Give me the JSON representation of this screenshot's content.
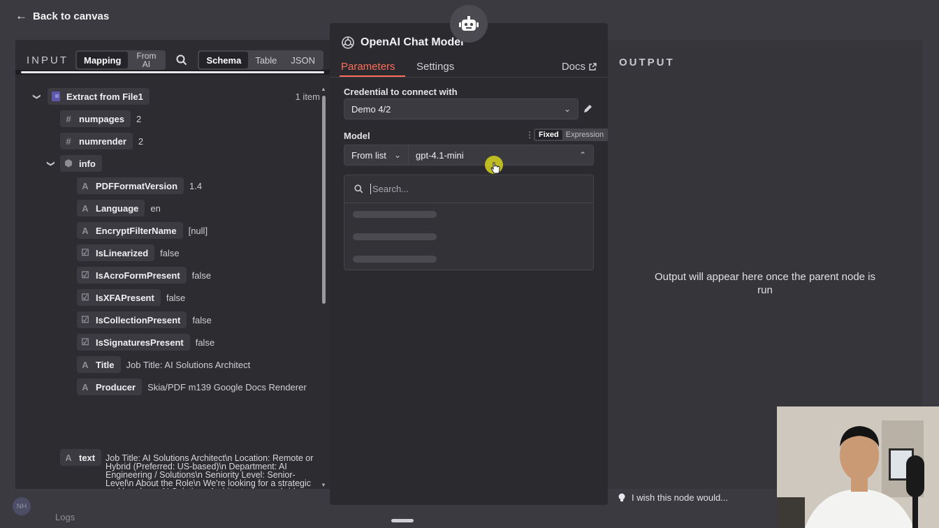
{
  "nav": {
    "back_label": "Back to canvas"
  },
  "input": {
    "title": "INPUT",
    "mode_options": [
      "Mapping",
      "From AI"
    ],
    "view_options": [
      "Schema",
      "Table",
      "JSON"
    ],
    "root": {
      "label": "Extract from File1",
      "count": "1 item"
    },
    "fields": [
      {
        "type": "#",
        "name": "numpages",
        "value": "2"
      },
      {
        "type": "#",
        "name": "numrender",
        "value": "2"
      },
      {
        "type": "obj",
        "name": "info",
        "value": ""
      }
    ],
    "info_fields": [
      {
        "type": "A",
        "name": "PDFFormatVersion",
        "value": "1.4"
      },
      {
        "type": "A",
        "name": "Language",
        "value": "en"
      },
      {
        "type": "A",
        "name": "EncryptFilterName",
        "value": "[null]"
      },
      {
        "type": "bool",
        "name": "IsLinearized",
        "value": "false"
      },
      {
        "type": "bool",
        "name": "IsAcroFormPresent",
        "value": "false"
      },
      {
        "type": "bool",
        "name": "IsXFAPresent",
        "value": "false"
      },
      {
        "type": "bool",
        "name": "IsCollectionPresent",
        "value": "false"
      },
      {
        "type": "bool",
        "name": "IsSignaturesPresent",
        "value": "false"
      },
      {
        "type": "A",
        "name": "Title",
        "value": "Job Title: AI Solutions Architect"
      },
      {
        "type": "A",
        "name": "Producer",
        "value": "Skia/PDF m139 Google Docs Renderer"
      }
    ],
    "text_field": {
      "name": "text",
      "value": "Job Title: AI Solutions Architect\\n Location: Remote or Hybrid (Preferred: US-based)\\n Department: AI Engineering / Solutions\\n Seniority Level: Senior-Level\\n About the Role\\n We're looking for a strategic and hands-on AI Solutions Architect who can bridge the gap\\n between business needs and technical implementation. You will work with cross-functional\\n teams to design, propose, and oversee the development of AI-powered solutions"
    }
  },
  "node": {
    "title": "OpenAI Chat Model",
    "tabs": [
      "Parameters",
      "Settings"
    ],
    "docs_label": "Docs",
    "credential_label": "Credential to connect with",
    "credential_value": "Demo 4/2",
    "model_label": "Model",
    "mode_toggle": [
      "Fixed",
      "Expression"
    ],
    "model_source": "From list",
    "model_value": "gpt-4.1-mini",
    "search_placeholder": "Search..."
  },
  "output": {
    "title": "OUTPUT",
    "empty_message": "Output will appear here once the parent node is run"
  },
  "footer": {
    "wish_label": "I wish this node would...",
    "logs_label": "Logs",
    "avatar_initials": "NH"
  },
  "colors": {
    "accent": "#ff6d5a",
    "panel": "#2c2c31",
    "pill": "#3b3b41",
    "cursor_highlight": "#d6d41e"
  },
  "icons": [
    "arrow-left-icon",
    "search-icon",
    "file-icon",
    "cube-icon",
    "checkbox-icon",
    "robot-icon",
    "openai-icon",
    "external-link-icon",
    "pencil-icon",
    "chevron-down-icon",
    "chevron-up-icon",
    "lightbulb-icon"
  ]
}
